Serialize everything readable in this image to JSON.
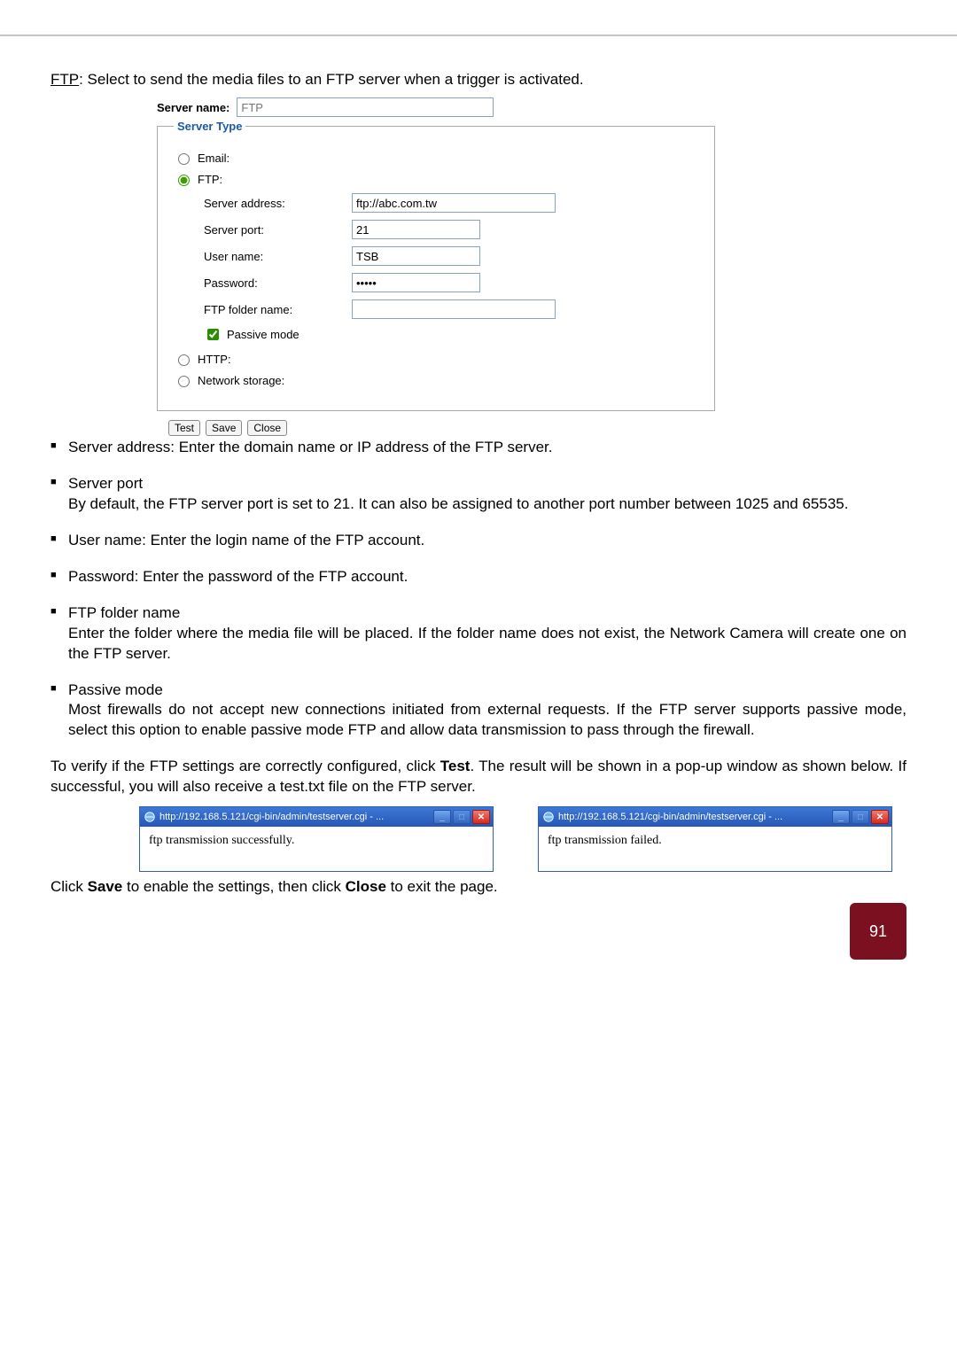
{
  "intro": {
    "ftp_key": "FTP",
    "ftp_text": ": Select to send the media files to an FTP server when a trigger is activated."
  },
  "form": {
    "server_name_label": "Server name:",
    "server_name_placeholder": "FTP",
    "fieldset_legend": "Server Type",
    "radios": {
      "email": "Email:",
      "ftp": "FTP:",
      "http": "HTTP:",
      "network_storage": "Network storage:"
    },
    "ftp_fields": {
      "server_address_label": "Server address:",
      "server_address_value": "ftp://abc.com.tw",
      "server_port_label": "Server port:",
      "server_port_value": "21",
      "user_name_label": "User name:",
      "user_name_value": "TSB",
      "password_label": "Password:",
      "password_value": "•••••",
      "ftp_folder_label": "FTP folder name:",
      "ftp_folder_value": "",
      "passive_mode_label": "Passive mode"
    },
    "buttons": {
      "test": "Test",
      "save": "Save",
      "close": "Close"
    }
  },
  "bullets": {
    "server_address": "Server address: Enter the domain name or IP address of the FTP server.",
    "server_port_head": "Server port",
    "server_port_body": "By default, the FTP server port is set to 21. It can also be assigned to another port number between 1025 and 65535.",
    "user_name": "User name: Enter the login name of the FTP account.",
    "password": "Password: Enter the password of the FTP account.",
    "ftp_folder_head": "FTP folder name",
    "ftp_folder_body": "Enter the folder where the media file will be placed. If the folder name does not exist, the Network Camera will create one on the FTP server.",
    "passive_head": "Passive mode",
    "passive_body": "Most firewalls do not accept new connections initiated from external requests. If the FTP server supports passive mode, select this option to enable passive mode FTP and allow data transmission to pass through the firewall."
  },
  "para_test_pre": "To verify if the FTP settings are correctly configured, click ",
  "para_test_bold": "Test",
  "para_test_post": ". The result will be shown in a pop-up window as shown below. If successful, you will also receive a test.txt file on the FTP server.",
  "popups": {
    "url": "http://192.168.5.121/cgi-bin/admin/testserver.cgi - ...",
    "success": "ftp transmission successfully.",
    "failed": "ftp transmission failed."
  },
  "final_pre": "Click ",
  "final_save": "Save",
  "final_mid": " to enable the settings, then click ",
  "final_close": "Close",
  "final_post": " to exit the page.",
  "page_number": "91"
}
